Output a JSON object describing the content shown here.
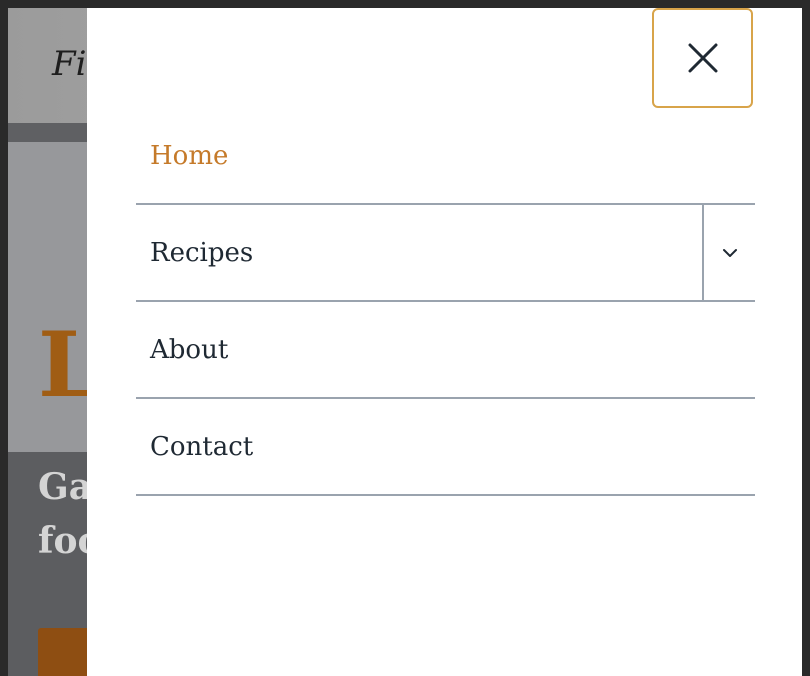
{
  "background": {
    "logo_text": "Fi",
    "hero_title_fragment": "L",
    "hero_subtitle_line1": "Ga",
    "hero_subtitle_line2": "foo"
  },
  "drawer": {
    "close_icon": "close-icon",
    "menu": [
      {
        "label": "Home",
        "active": true,
        "has_submenu": false
      },
      {
        "label": "Recipes",
        "active": false,
        "has_submenu": true,
        "submenu_icon": "chevron-down-icon"
      },
      {
        "label": "About",
        "active": false,
        "has_submenu": false
      },
      {
        "label": "Contact",
        "active": false,
        "has_submenu": false
      }
    ]
  },
  "colors": {
    "accent": "#c57a2a",
    "close_border": "#d8a44a",
    "divider": "#9aa3ae",
    "text": "#1f2933",
    "hero_title": "#a05d14"
  }
}
